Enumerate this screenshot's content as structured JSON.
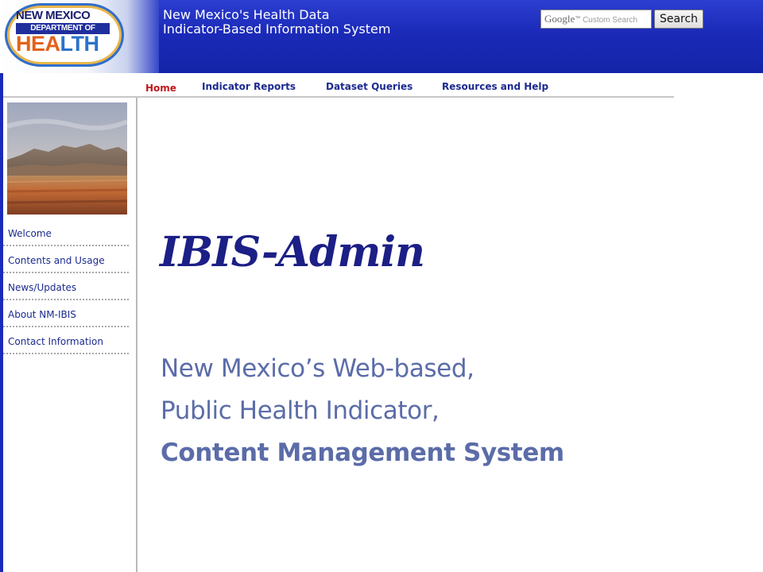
{
  "header": {
    "logo": {
      "line1": "NEW MEXICO",
      "line2": "DEPARTMENT OF",
      "line3_part1": "HEA",
      "line3_part2": "LTH"
    },
    "site_title_line1": "New Mexico's Health Data",
    "site_title_line2": "Indicator-Based Information System",
    "search": {
      "google_label": "Google",
      "placeholder": "Custom Search",
      "button_label": "Search"
    }
  },
  "top_nav": {
    "items": [
      {
        "label": "Home",
        "active": true
      },
      {
        "label": "Indicator Reports",
        "active": false
      },
      {
        "label": "Dataset Queries",
        "active": false
      },
      {
        "label": "Resources and Help",
        "active": false
      }
    ]
  },
  "sidebar": {
    "items": [
      {
        "label": "Welcome"
      },
      {
        "label": "Contents and Usage"
      },
      {
        "label": "News/Updates"
      },
      {
        "label": "About NM-IBIS"
      },
      {
        "label": "Contact Information"
      }
    ]
  },
  "main": {
    "title": "IBIS-Admin",
    "subtitle_lines": [
      "New Mexico’s Web-based,",
      "Public Health Indicator,",
      "Content Management System"
    ]
  },
  "colors": {
    "header_blue": "#1b2ab8",
    "nav_text": "#1b2a8f",
    "nav_active": "#c0181c",
    "title_navy": "#1c1f85",
    "subtitle_blue": "#5b6ca8"
  }
}
